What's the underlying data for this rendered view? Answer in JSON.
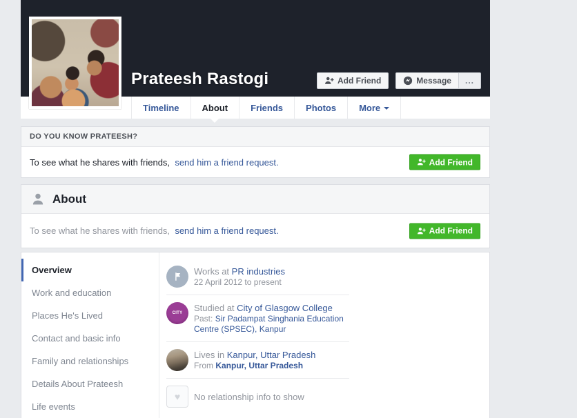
{
  "header": {
    "name": "Prateesh Rastogi",
    "actions": {
      "add_friend": "Add Friend",
      "message": "Message",
      "more": "..."
    },
    "tabs": [
      {
        "label": "Timeline",
        "active": false
      },
      {
        "label": "About",
        "active": true
      },
      {
        "label": "Friends",
        "active": false
      },
      {
        "label": "Photos",
        "active": false
      },
      {
        "label": "More",
        "active": false,
        "caret": true
      }
    ]
  },
  "know_section": {
    "title": "DO YOU KNOW PRATEESH?",
    "body_text": "To see what he shares with friends,",
    "body_link": "send him a friend request.",
    "add_friend_label": "Add Friend"
  },
  "about_section": {
    "title": "About",
    "body_text": "To see what he shares with friends,",
    "body_link": "send him a friend request.",
    "add_friend_label": "Add Friend"
  },
  "about_nav": {
    "items": [
      {
        "label": "Overview",
        "active": true
      },
      {
        "label": "Work and education",
        "active": false
      },
      {
        "label": "Places He's Lived",
        "active": false
      },
      {
        "label": "Contact and basic info",
        "active": false
      },
      {
        "label": "Family and relationships",
        "active": false
      },
      {
        "label": "Details About Prateesh",
        "active": false
      },
      {
        "label": "Life events",
        "active": false
      }
    ]
  },
  "overview": {
    "work": {
      "prefix": "Works at ",
      "link": "PR industries",
      "sub": "22 April 2012 to present"
    },
    "education": {
      "prefix": "Studied at ",
      "link": "City of Glasgow College",
      "sub_prefix": "Past: ",
      "sub_link": "Sir Padampat Singhania Education Centre (SPSEC), Kanpur"
    },
    "lives": {
      "prefix": "Lives in ",
      "link": "Kanpur, Uttar Pradesh",
      "sub_prefix": "From ",
      "sub_link": "Kanpur, Uttar Pradesh"
    },
    "relationship": {
      "text": "No relationship info to show"
    }
  },
  "icons": {
    "add_friend": "person-plus-icon",
    "message": "messenger-icon",
    "more_options": "ellipsis-icon",
    "about_header": "person-silhouette-icon",
    "work": "flag-icon",
    "education": "city-of-glasgow-logo",
    "education_logo_text": "CITY",
    "lives": "city-photo-icon",
    "relationship": "heart-icon",
    "relationship_glyph": "♥",
    "more_tab_caret": "chevron-down-icon"
  },
  "colors": {
    "page_bg": "#e9ebee",
    "cover_bg": "#1e222b",
    "accent_green": "#42b72a",
    "link_blue": "#365899",
    "active_tab_text": "#1d2129",
    "sidebar_active_bar": "#4267b2",
    "muted_text": "#90949c"
  }
}
